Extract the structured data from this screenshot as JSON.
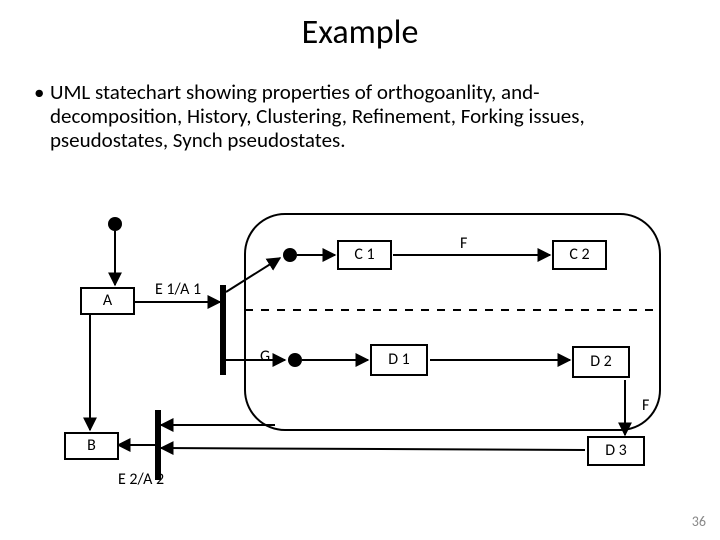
{
  "title": "Example",
  "bullet": "UML statechart showing properties of orthogoanlity, and-decomposition, History, Clustering, Refinement, Forking issues, pseudostates, Synch pseudostates.",
  "states": {
    "A": "A",
    "B": "B",
    "C1": "C 1",
    "C2": "C 2",
    "D1": "D 1",
    "D2": "D 2",
    "D3": "D 3"
  },
  "transitions": {
    "E1A1": "E 1/A 1",
    "E2A2": "E 2/A 2",
    "G": "G",
    "F_top": "F",
    "F_right": "F"
  },
  "slide_number": "36"
}
